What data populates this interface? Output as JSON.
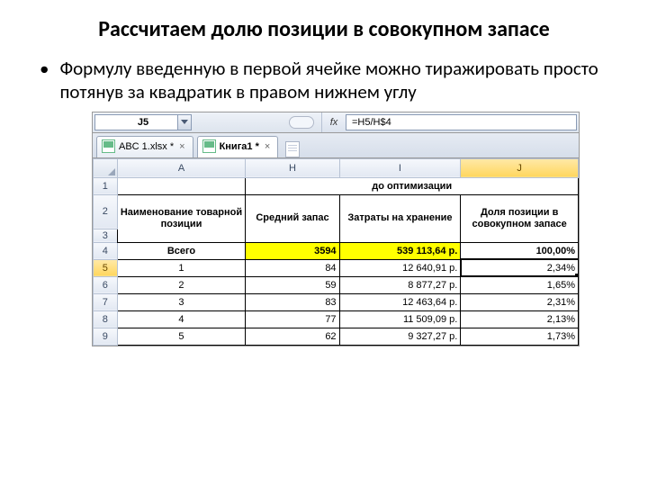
{
  "slide": {
    "title": "Рассчитаем долю позиции в совокупном запасе",
    "bullet": "Формулу введенную в первой ячейке можно тиражировать просто потянув за квадратик в правом нижнем углу"
  },
  "excel": {
    "name_box": "J5",
    "fx_label": "fx",
    "formula": "=H5/H$4",
    "tabs": {
      "tab1": "ABC 1.xlsx *",
      "tab2": "Книга1 *",
      "close": "×"
    },
    "col_headers": {
      "A": "A",
      "H": "H",
      "I": "I",
      "J": "J"
    },
    "row_headers": {
      "r1": "1",
      "r2": "2",
      "r3": "3",
      "r4": "4",
      "r5": "5",
      "r6": "6",
      "r7": "7",
      "r8": "8",
      "r9": "9"
    },
    "merge_header": "до оптимизации",
    "headers": {
      "A": "Наименование товарной позиции",
      "H": "Средний запас",
      "I": "Затраты на хранение",
      "J": "Доля позиции в совокупном запасе"
    },
    "rows": {
      "total_label": "Всего",
      "r4": {
        "H": "3594",
        "I": "539 113,64 р.",
        "J": "100,00%"
      },
      "r5": {
        "A": "1",
        "H": "84",
        "I": "12 640,91 р.",
        "J": "2,34%"
      },
      "r6": {
        "A": "2",
        "H": "59",
        "I": "8 877,27 р.",
        "J": "1,65%"
      },
      "r7": {
        "A": "3",
        "H": "83",
        "I": "12 463,64 р.",
        "J": "2,31%"
      },
      "r8": {
        "A": "4",
        "H": "77",
        "I": "11 509,09 р.",
        "J": "2,13%"
      },
      "r9": {
        "A": "5",
        "H": "62",
        "I": "9 327,27 р.",
        "J": "1,73%"
      }
    }
  },
  "chart_data": {
    "type": "table",
    "title": "до оптимизации",
    "columns": [
      "Наименование товарной позиции",
      "Средний запас",
      "Затраты на хранение",
      "Доля позиции в совокупном запасе"
    ],
    "rows": [
      {
        "Наименование товарной позиции": "Всего",
        "Средний запас": 3594,
        "Затраты на хранение": 539113.64,
        "Доля позиции в совокупном запасе": 100.0
      },
      {
        "Наименование товарной позиции": "1",
        "Средний запас": 84,
        "Затраты на хранение": 12640.91,
        "Доля позиции в совокупном запасе": 2.34
      },
      {
        "Наименование товарной позиции": "2",
        "Средний запас": 59,
        "Затраты на хранение": 8877.27,
        "Доля позиции в совокупном запасе": 1.65
      },
      {
        "Наименование товарной позиции": "3",
        "Средний запас": 83,
        "Затраты на хранение": 12463.64,
        "Доля позиции в совокупном запасе": 2.31
      },
      {
        "Наименование товарной позиции": "4",
        "Средний запас": 77,
        "Затраты на хранение": 11509.09,
        "Доля позиции в совокупном запасе": 2.13
      },
      {
        "Наименование товарной позиции": "5",
        "Средний запас": 62,
        "Затраты на хранение": 9327.27,
        "Доля позиции в совокупном запасе": 1.73
      }
    ]
  }
}
